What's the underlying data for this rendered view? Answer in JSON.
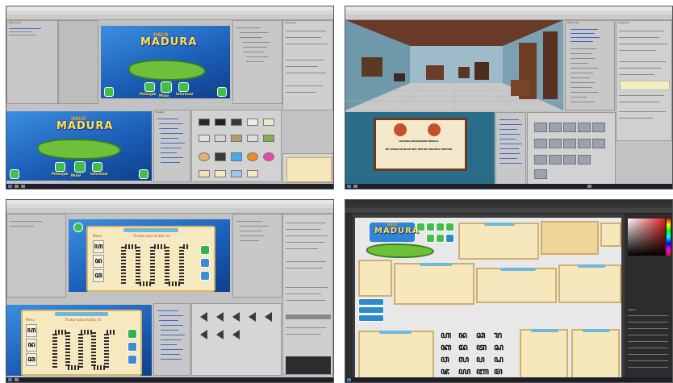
{
  "panel_top_left": {
    "game_title_top": "HALO",
    "game_title": "MADURA",
    "menu_labels": [
      "Petunjuk",
      "Mulai",
      "Informasi"
    ],
    "hierarchy_header": "Hierarchy",
    "project_header": "Project",
    "inspector_header": "Inspector"
  },
  "panel_top_right": {
    "sign_title": "GELENG-GELENGKAN KEPALA",
    "sign_text": "KE KANAN DAN KE KIRI UNTUK MELIHAT SEKITAR",
    "hierarchy_header": "Hierarchy",
    "inspector_header": "Inspector"
  },
  "panel_bottom_left": {
    "left_header": "Menu",
    "instruction": "Tirukan pola di atas ini",
    "script_chars": [
      "ꦲ",
      "ꦤ",
      "ꦕ"
    ]
  },
  "panel_bottom_right": {
    "game_title_top": "HALO",
    "game_title": "MADURA",
    "layers_header": "Layers",
    "glyph_rows": [
      [
        "ꦲ",
        "ꦤ",
        "ꦕ",
        "ꦫ"
      ],
      [
        "ꦏ",
        "ꦢ",
        "ꦠ",
        "ꦱ"
      ],
      [
        "ꦮ",
        "ꦭ",
        "ꦥ",
        "ꦝ"
      ],
      [
        "ꦗ",
        "ꦪ",
        "ꦚ",
        "ꦩ"
      ]
    ]
  }
}
